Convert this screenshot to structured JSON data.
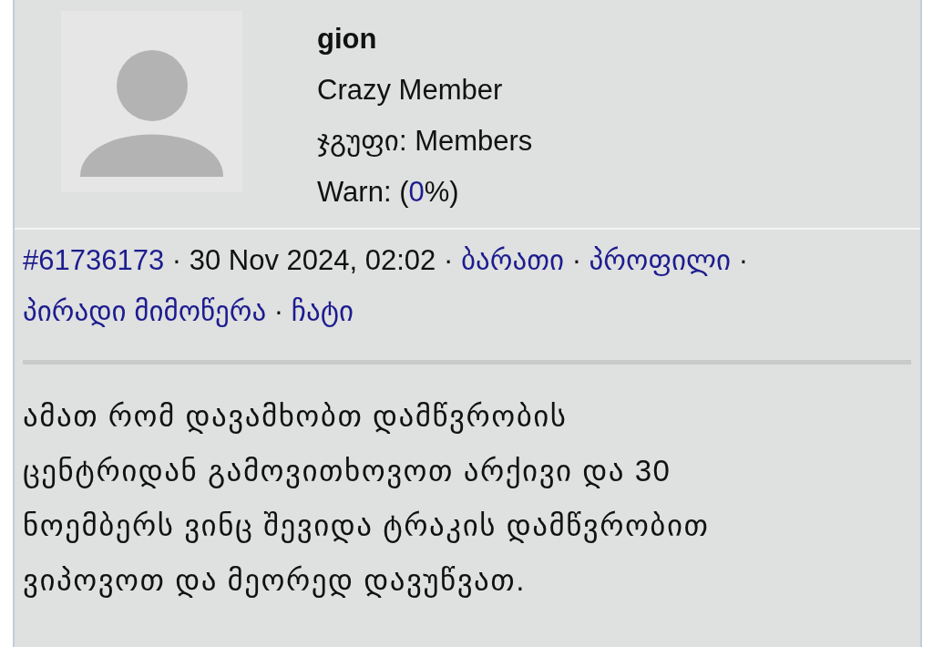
{
  "author": {
    "name": "gion",
    "rank": "Crazy Member",
    "group": "ჯგუფი: Members",
    "warn": [
      {
        "kind": "text",
        "text": "Warn: ("
      },
      {
        "kind": "link",
        "text": "0"
      },
      {
        "kind": "text",
        "text": "%)"
      }
    ]
  },
  "meta": [
    {
      "kind": "link",
      "text": "#61736173"
    },
    {
      "kind": "separator",
      "text": "·"
    },
    {
      "kind": "text",
      "text": "30 Nov 2024, 02:02"
    },
    {
      "kind": "separator",
      "text": "·"
    },
    {
      "kind": "link",
      "text": "ბარათი"
    },
    {
      "kind": "separator",
      "text": "·"
    },
    {
      "kind": "link",
      "text": "პროფილი"
    },
    {
      "kind": "separator",
      "text": "·"
    },
    {
      "kind": "link",
      "text": "პირადი მიმოწერა"
    },
    {
      "kind": "separator",
      "text": "·"
    },
    {
      "kind": "link",
      "text": "ჩატი"
    }
  ],
  "body": "ამათ რომ დავამხობთ დამწვრობის ცენტრიდან გამოვითხოვოთ არქივი და 30 ნოემბერს ვინც შევიდა ტრაკის დამწვრობით ვიპოვოთ და მეორედ დავუწვათ."
}
